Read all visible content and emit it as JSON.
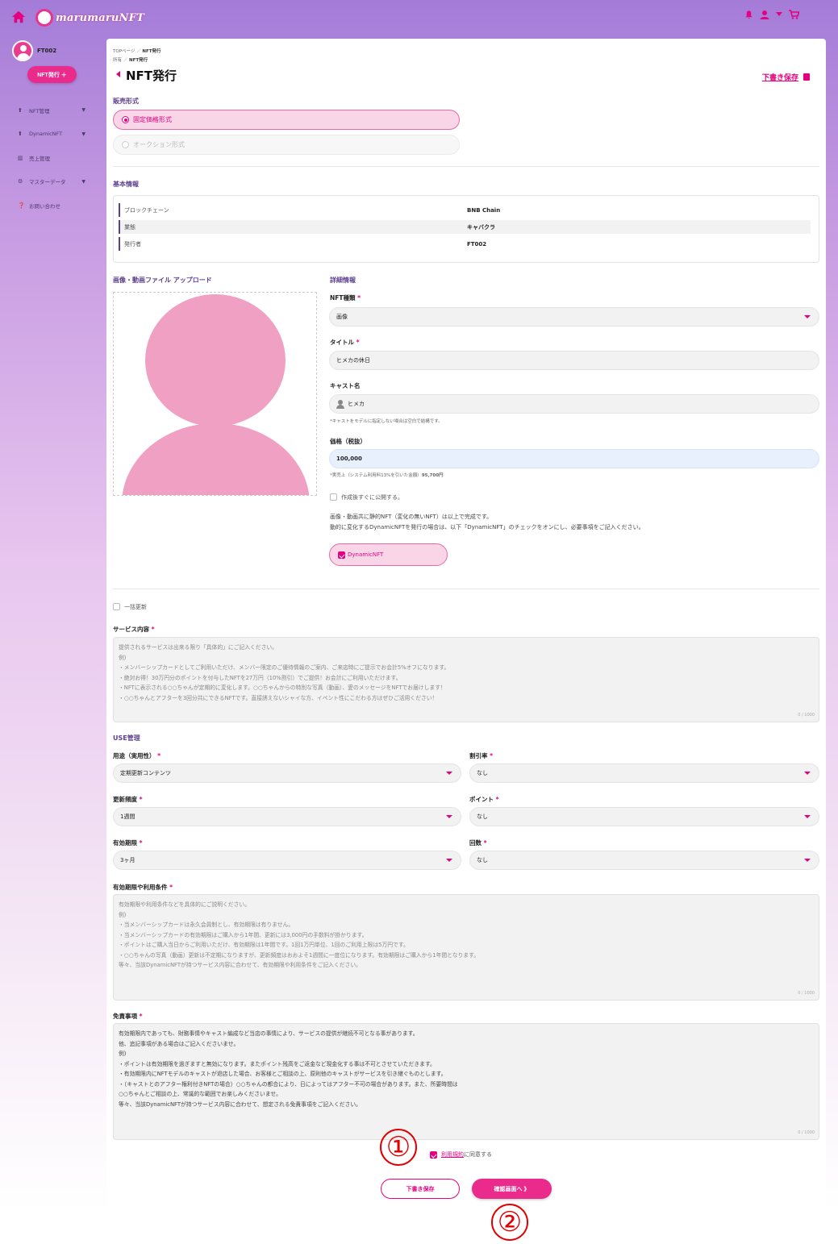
{
  "header": {
    "logo_text": "marumaruNFT",
    "icons": [
      "home-icon",
      "notification-icon",
      "user-icon",
      "chevron-down-icon",
      "cart-icon"
    ]
  },
  "sidebar": {
    "username": "FT002",
    "nft_button": "NFT発行 ＋",
    "items": [
      {
        "label": "NFT管理",
        "icon": "arrow-icon",
        "expandable": true
      },
      {
        "label": "DynamicNFT",
        "icon": "arrow-icon",
        "expandable": true
      },
      {
        "label": "売上管理",
        "icon": "chart-icon",
        "expandable": false
      },
      {
        "label": "マスターデータ",
        "icon": "gear-icon",
        "expandable": true
      },
      {
        "label": "お問い合わせ",
        "icon": "question-icon",
        "expandable": false
      }
    ]
  },
  "breadcrumb": {
    "line1_a": "TOPページ",
    "sep1": "／",
    "line1_b": "NFT発行",
    "line2_a": "所有",
    "sep2": "／",
    "line2_b": "NFT発行"
  },
  "page": {
    "title": "NFT発行",
    "draft_link": "下書き保存"
  },
  "sale_format": {
    "title": "販売形式",
    "options": [
      {
        "label": "固定価格形式",
        "selected": true
      },
      {
        "label": "オークション形式",
        "selected": false
      }
    ]
  },
  "basic_info": {
    "title": "基本情報",
    "rows": [
      {
        "key": "ブロックチェーン",
        "value": "BNB Chain"
      },
      {
        "key": "業態",
        "value": "キャバクラ"
      },
      {
        "key": "発行者",
        "value": "FT002"
      }
    ]
  },
  "upload": {
    "title": "画像・動画ファイル アップロード"
  },
  "details": {
    "title": "詳細情報",
    "nft_type_label": "NFT種類",
    "nft_type_value": "画像",
    "title_label": "タイトル",
    "title_value": "ヒメカの休日",
    "cast_label": "キャスト名",
    "cast_value": "ヒメカ",
    "cast_note": "*キャストをモデルに指定しない場合は空白で結構です。",
    "price_label": "価格（税抜）",
    "price_value": "100,000",
    "price_note_prefix": "*実売上（システム利用料13%を引いた金額）",
    "price_note_value": "95,700円",
    "publish_label": "作成後すぐに公開する。",
    "desc_line1": "画像・動画共に静的NFT（変化の無いNFT）は以上で完成です。",
    "desc_line2": "動的に変化するDynamicNFTを発行の場合は、以下「DynamicNFT」のチェックをオンにし、必要事項をご記入ください。",
    "dynamic_label": "DynamicNFT"
  },
  "bulk_update": {
    "label": "一括更新"
  },
  "service": {
    "label": "サービス内容",
    "placeholder_lines": [
      "提供されるサービスは出来る限り「具体的」にご記入ください。",
      "例)",
      "・メンバーシップカードとしてご利用いただけ、メンバー限定のご優待情報のご案内、ご来店時にご提示でお会計5%オフになります。",
      "・絶対お得！30万円分のポイントを付与したNFTを27万円（10%割引）でご提供！お会計にご利用いただけます。",
      "・NFTに表示される○○ちゃんが定期的に変化します。○○ちゃんからの特別な写真（動画）、愛のメッセージをNFTでお届けします！",
      "・○○ちゃんとアフターを3回分共にできるNFTです。直接誘えないシャイな方、イベント性にこだわる方はぜひご活用ください！"
    ],
    "counter": "0 / 1000"
  },
  "use_mgmt": {
    "title": "USE管理",
    "fields": [
      {
        "label": "用途（実用性）",
        "value": "定期更新コンテンツ"
      },
      {
        "label": "割引率",
        "value": "なし"
      },
      {
        "label": "更新頻度",
        "value": "1週間"
      },
      {
        "label": "ポイント",
        "value": "なし"
      },
      {
        "label": "有効期限",
        "value": "3ヶ月"
      },
      {
        "label": "回数",
        "value": "なし"
      }
    ]
  },
  "terms": {
    "label": "有効期限や利用条件",
    "placeholder_lines": [
      "有効期限や利用条件などを具体的にご説明ください。",
      "例)",
      "・当メンバーシップカードは永久会員制とし、有効期限は有りません。",
      "・当メンバーシップカードの有効期限はご購入から1年間、更新には3,000円の手数料が掛かります。",
      "・ポイントはご購入当日からご利用いただけ、有効期限は1年間です。1回1万円単位、1回のご利用上限は5万円です。",
      "・○○ちゃんの写真（動画）更新は不定期になりますが、更新頻度はおおよそ1週間に一度位になります。有効期限はご購入から1年間となります。",
      "等々、当該DynamicNFTが持つサービス内容に合わせて、有効期限や利用条件をご記入ください。"
    ],
    "counter": "0 / 1000"
  },
  "disclaimer": {
    "label": "免責事項",
    "lines": [
      "有効期限内であっても、財務事情やキャスト編成など当店の事情により、サービスの提供が継続不可となる事があります。",
      "他、追記事項がある場合はご記入くださいませ。",
      "例)",
      "・ポイントは有効期限を過ぎますと無効になります。またポイント残高をご返金など現金化する事は不可とさせていただきます。",
      "・有効期限内にNFTモデルのキャストが退店した場合、お客様とご相談の上、原則他のキャストがサービスを引き継ぐものとします。",
      "・（キャストとのアフター権利付きNFTの場合）○○ちゃんの都合により、日によってはアフター不可の場合があります。また、所要時間は",
      "○○ちゃんとご相談の上、常識的な範囲でお楽しみくださいませ。",
      "等々、当該DynamicNFTが持つサービス内容に合わせて、想定される免責事項をご記入ください。"
    ],
    "counter": "0 / 1000"
  },
  "agreement": {
    "link": "利用規約",
    "suffix": "に同意する",
    "checked": true
  },
  "buttons": {
    "draft": "下書き保存",
    "confirm": "確認画面へ 》"
  },
  "markers": {
    "one": "①",
    "two": "②"
  },
  "colors": {
    "accent": "#e5007f",
    "section": "#5d3f8f"
  }
}
